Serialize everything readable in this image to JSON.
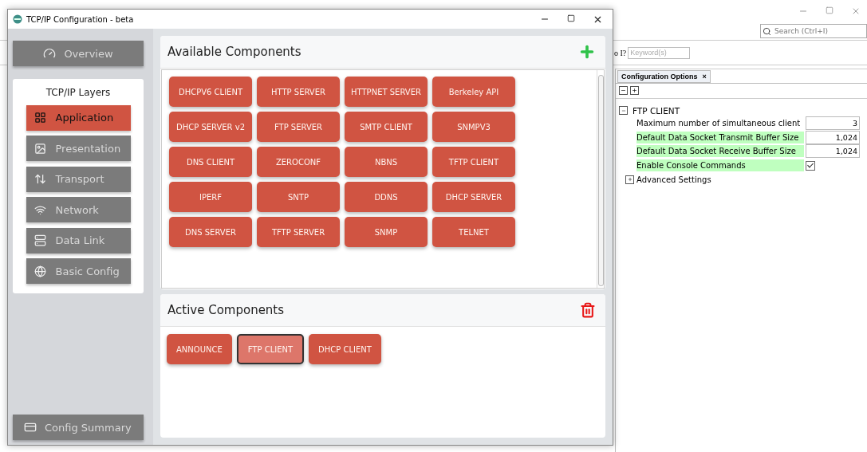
{
  "dialog": {
    "title": "TCP/IP Configuration - beta",
    "overview": "Overview",
    "layers_title": "TCP/IP Layers",
    "layers": [
      {
        "label": "Application",
        "selected": true
      },
      {
        "label": "Presentation",
        "selected": false
      },
      {
        "label": "Transport",
        "selected": false
      },
      {
        "label": "Network",
        "selected": false
      },
      {
        "label": "Data Link",
        "selected": false
      },
      {
        "label": "Basic Config",
        "selected": false
      }
    ],
    "config_summary": "Config Summary",
    "available": {
      "title": "Available Components",
      "items": [
        "DHCPV6 CLIENT",
        "HTTP SERVER",
        "HTTPNET SERVER",
        "Berkeley API",
        "DHCP SERVER v2",
        "FTP SERVER",
        "SMTP CLIENT",
        "SNMPV3",
        "DNS CLIENT",
        "ZEROCONF",
        "NBNS",
        "TFTP CLIENT",
        "IPERF",
        "SNTP",
        "DDNS",
        "DHCP SERVER",
        "DNS SERVER",
        "TFTP SERVER",
        "SNMP",
        "TELNET"
      ]
    },
    "active": {
      "title": "Active Components",
      "items": [
        {
          "label": "ANNOUNCE",
          "selected": false
        },
        {
          "label": "FTP CLIENT",
          "selected": true
        },
        {
          "label": "DHCP CLIENT",
          "selected": false
        }
      ]
    }
  },
  "ide": {
    "search_placeholder": "Search (Ctrl+I)",
    "question": "o I?",
    "keyword_placeholder": "Keyword(s)",
    "panel_tab": "Configuration Options",
    "tab_close": "×",
    "tree": {
      "label": "FTP CLIENT",
      "expanded": true,
      "children": [
        {
          "label": "Maximum number of simultaneous client",
          "kind": "number",
          "value": "3",
          "highlighted": false
        },
        {
          "label": "Default Data Socket Transmit Buffer Size",
          "kind": "number",
          "value": "1,024",
          "highlighted": true
        },
        {
          "label": "Default Data Socket Receive Buffer Size",
          "kind": "number",
          "value": "1,024",
          "highlighted": true
        },
        {
          "label": "Enable Console Commands",
          "kind": "checkbox",
          "checked": true,
          "highlighted": true
        },
        {
          "label": "Advanced Settings",
          "kind": "group",
          "expanded": false
        }
      ]
    }
  }
}
